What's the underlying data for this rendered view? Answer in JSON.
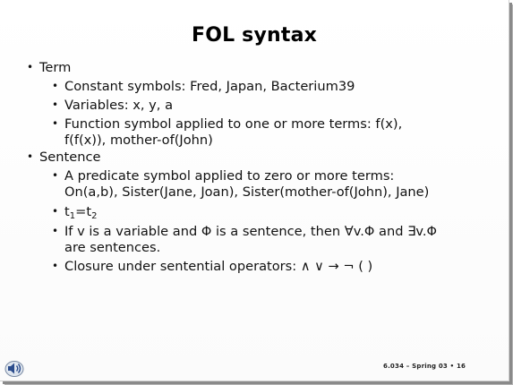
{
  "slide": {
    "title": "FOL syntax",
    "items": [
      {
        "bullet": "•",
        "text": "Term"
      },
      {
        "bullet": "•",
        "text": "Constant symbols: Fred, Japan, Bacterium39"
      },
      {
        "bullet": "•",
        "text": "Variables: x, y, a"
      },
      {
        "bullet": "•",
        "text": "Function symbol applied to one or more terms: f(x),",
        "cont": "f(f(x)), mother-of(John)"
      },
      {
        "bullet": "•",
        "text": "Sentence"
      },
      {
        "bullet": "•",
        "text": "A predicate symbol applied to zero or more terms:",
        "cont": "On(a,b), Sister(Jane, Joan), Sister(mother-of(John), Jane)"
      },
      {
        "bullet": "•",
        "t": "t",
        "sub1": "1",
        "eq": "=t",
        "sub2": "2"
      },
      {
        "bullet": "•",
        "text": "If v is a variable and Φ is a sentence, then ∀v.Φ and ∃v.Φ",
        "cont": "are sentences."
      },
      {
        "bullet": "•",
        "text": "Closure under sentential operators:  ∧ ∨ → ¬ ( )"
      }
    ],
    "footer": "6.034 – Spring 03 • 16"
  },
  "icons": {
    "speaker": "speaker-icon"
  }
}
